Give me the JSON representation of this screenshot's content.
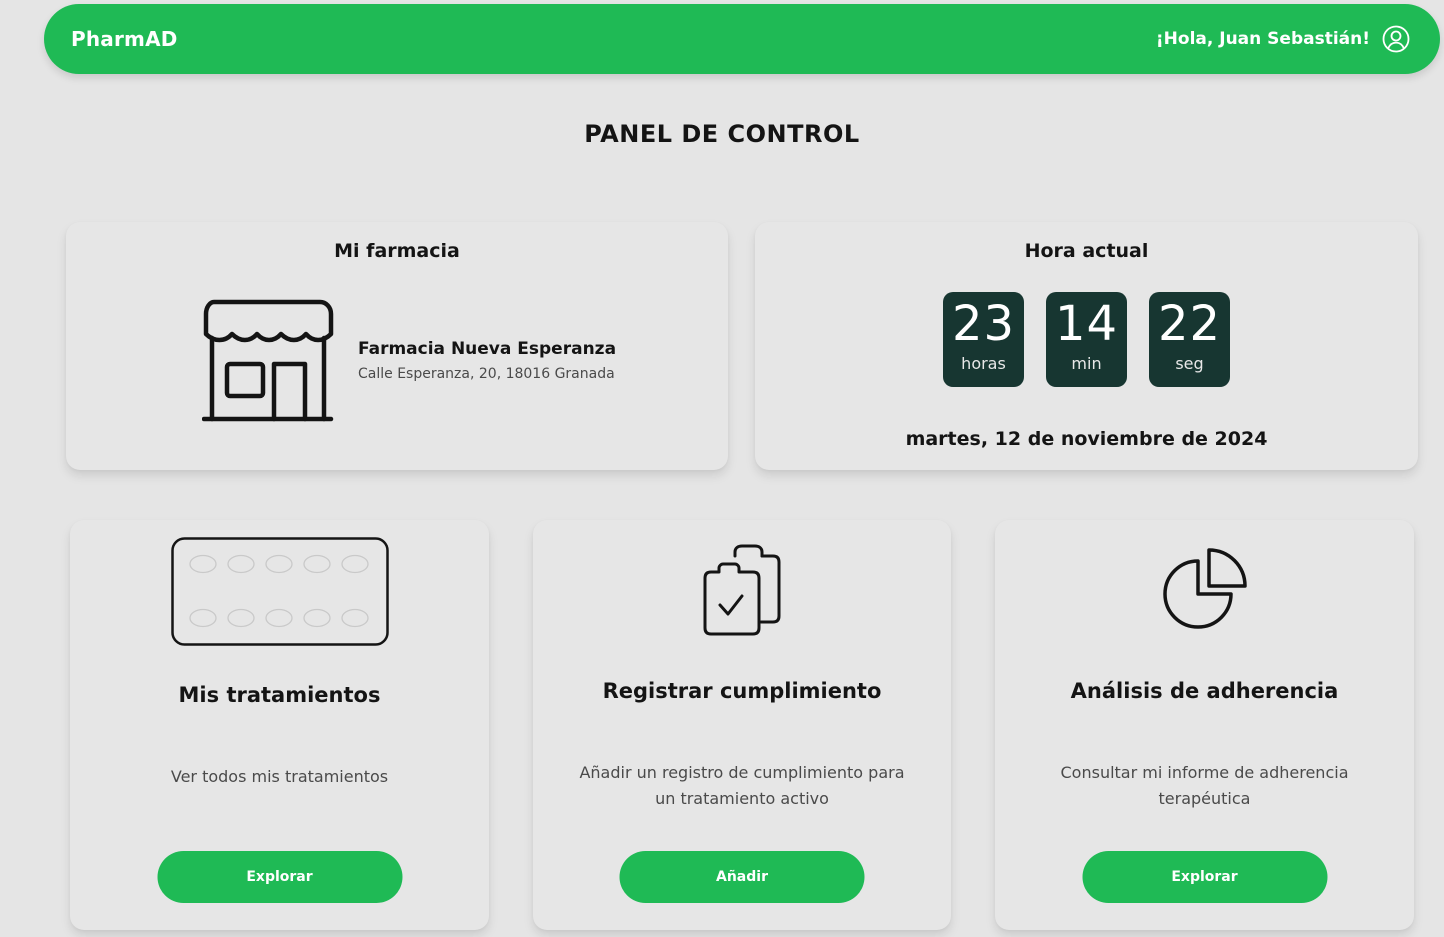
{
  "navbar": {
    "brand": "PharmAD",
    "greeting": "¡Hola, Juan Sebastián!",
    "user_icon": "user-circle-icon",
    "color": "#1fba55"
  },
  "page": {
    "title": "PANEL DE CONTROL"
  },
  "pharmacy_card": {
    "title": "Mi farmacia",
    "icon": "store-icon",
    "name": "Farmacia Nueva Esperanza",
    "address": "Calle Esperanza, 20, 18016 Granada"
  },
  "time_card": {
    "title": "Hora actual",
    "hours": "23",
    "hours_label": "horas",
    "minutes": "14",
    "minutes_label": "min",
    "seconds": "22",
    "seconds_label": "seg",
    "date": "martes, 12 de noviembre de 2024",
    "box_color": "#173631"
  },
  "features": {
    "treatments": {
      "icon": "pill-blister-icon",
      "title": "Mis tratamientos",
      "description": "Ver todos mis tratamientos",
      "button": "Explorar"
    },
    "register": {
      "icon": "clipboard-check-icon",
      "title": "Registrar cumplimiento",
      "description": "Añadir un registro de cumplimiento para un tratamiento activo",
      "button": "Añadir"
    },
    "analysis": {
      "icon": "pie-chart-icon",
      "title": "Análisis de adherencia",
      "description": "Consultar mi informe de adherencia terapéutica",
      "button": "Explorar"
    }
  }
}
